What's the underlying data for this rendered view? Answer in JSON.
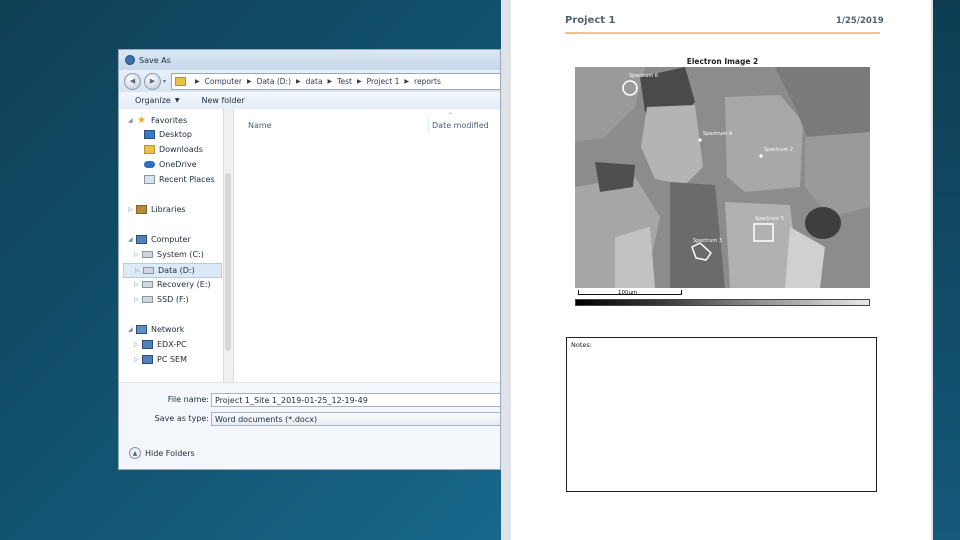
{
  "dialog": {
    "title": "Save As",
    "address": {
      "crumbs": [
        "Computer",
        "Data (D:)",
        "data",
        "Test",
        "Project 1",
        "reports"
      ]
    },
    "toolbar": {
      "organize": "Organize",
      "new_folder": "New folder"
    },
    "nav": {
      "favorites": "Favorites",
      "desktop": "Desktop",
      "downloads": "Downloads",
      "onedrive": "OneDrive",
      "recent": "Recent Places",
      "libraries": "Libraries",
      "computer": "Computer",
      "system": "System (C:)",
      "data": "Data (D:)",
      "recovery": "Recovery (E:)",
      "ssd": "SSD (F:)",
      "network": "Network",
      "edx_pc": "EDX-PC",
      "pc_sem": "PC SEM"
    },
    "columns": {
      "name": "Name",
      "date_modified": "Date modified"
    },
    "file_name_label": "File name:",
    "file_name_value": "Project 1_Site 1_2019-01-25_12-19-49",
    "save_type_label": "Save as type:",
    "save_type_value": "Word documents (*.docx)",
    "hide_folders": "Hide Folders"
  },
  "document": {
    "title": "Project 1",
    "date": "1/25/2019",
    "image_title": "Electron Image 2",
    "scale": "100µm",
    "spectra": [
      "Spectrum 6",
      "Spectrum 4",
      "Spectrum 2",
      "Spectrum 5",
      "Spectrum 3"
    ],
    "notes_label": "Notes:"
  }
}
